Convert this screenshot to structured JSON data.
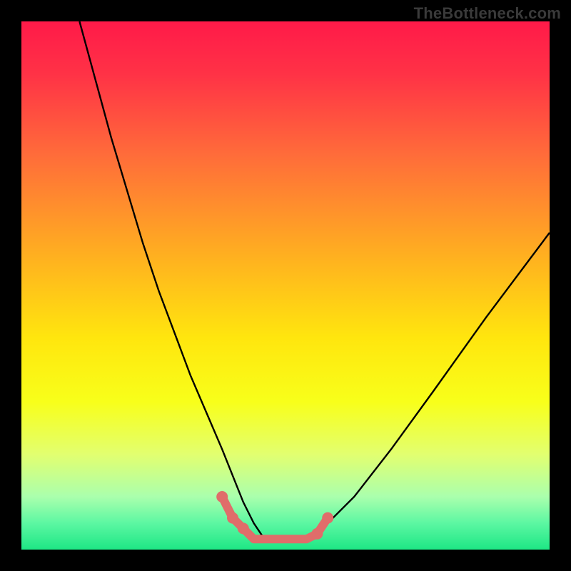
{
  "attribution": "TheBottleneck.com",
  "chart_data": {
    "type": "line",
    "title": "",
    "xlabel": "",
    "ylabel": "",
    "xlim": [
      0,
      100
    ],
    "ylim": [
      0,
      100
    ],
    "background_gradient_stops": [
      {
        "offset": 0.0,
        "color": "#ff1a49"
      },
      {
        "offset": 0.1,
        "color": "#ff3246"
      },
      {
        "offset": 0.25,
        "color": "#ff6b3a"
      },
      {
        "offset": 0.45,
        "color": "#ffb21f"
      },
      {
        "offset": 0.6,
        "color": "#ffe60e"
      },
      {
        "offset": 0.72,
        "color": "#f8ff1a"
      },
      {
        "offset": 0.82,
        "color": "#e2ff70"
      },
      {
        "offset": 0.9,
        "color": "#aaffad"
      },
      {
        "offset": 0.95,
        "color": "#5cf7a2"
      },
      {
        "offset": 1.0,
        "color": "#1ee785"
      }
    ],
    "series": [
      {
        "name": "bottleneck-curve",
        "color": "#000000",
        "x": [
          11,
          14,
          17,
          20,
          23,
          26,
          29,
          32,
          35,
          38,
          40,
          42,
          44,
          46,
          50,
          54,
          58,
          63,
          70,
          78,
          88,
          100
        ],
        "y": [
          100,
          89,
          78,
          68,
          58,
          49,
          41,
          33,
          26,
          19,
          14,
          9,
          5,
          2,
          2,
          2,
          5,
          10,
          19,
          30,
          44,
          60
        ]
      }
    ],
    "highlight_segment": {
      "name": "optimal-zone",
      "color": "#e06d6a",
      "x": [
        38,
        40,
        42,
        44,
        46,
        48,
        50,
        52,
        54,
        56,
        58
      ],
      "y": [
        10,
        6,
        4,
        2,
        2,
        2,
        2,
        2,
        2,
        3,
        6
      ],
      "dot_x": [
        38,
        40,
        42,
        56,
        58
      ],
      "dot_y": [
        10,
        6,
        4,
        3,
        6
      ]
    }
  }
}
